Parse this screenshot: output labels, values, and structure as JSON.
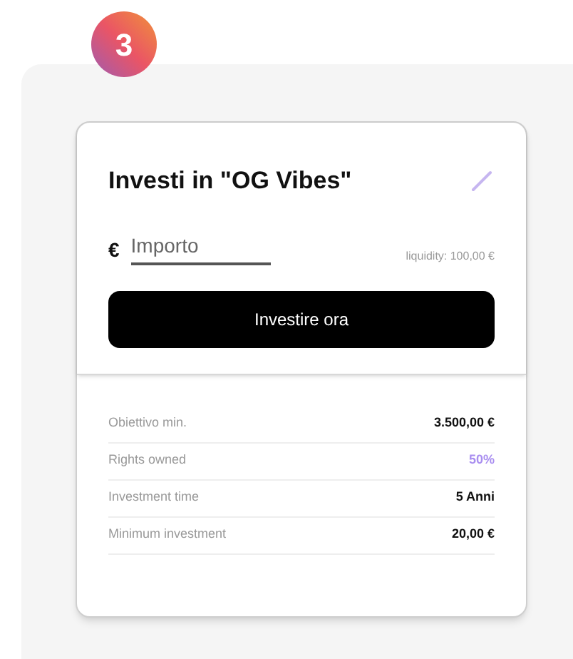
{
  "step": "3",
  "title": "Investi in \"OG Vibes\"",
  "amount": {
    "currency": "€",
    "placeholder": "Importo"
  },
  "liquidity": "liquidity: 100,00 €",
  "button": "Investire ora",
  "details": [
    {
      "label": "Obiettivo min.",
      "value": "3.500,00 €",
      "kind": "plain"
    },
    {
      "label": "Rights owned",
      "value": "50%",
      "kind": "accent"
    },
    {
      "label": "Investment time",
      "value": "5 Anni",
      "kind": "plain"
    },
    {
      "label": "Minimum investment",
      "value": "20,00 €",
      "kind": "plain"
    }
  ]
}
